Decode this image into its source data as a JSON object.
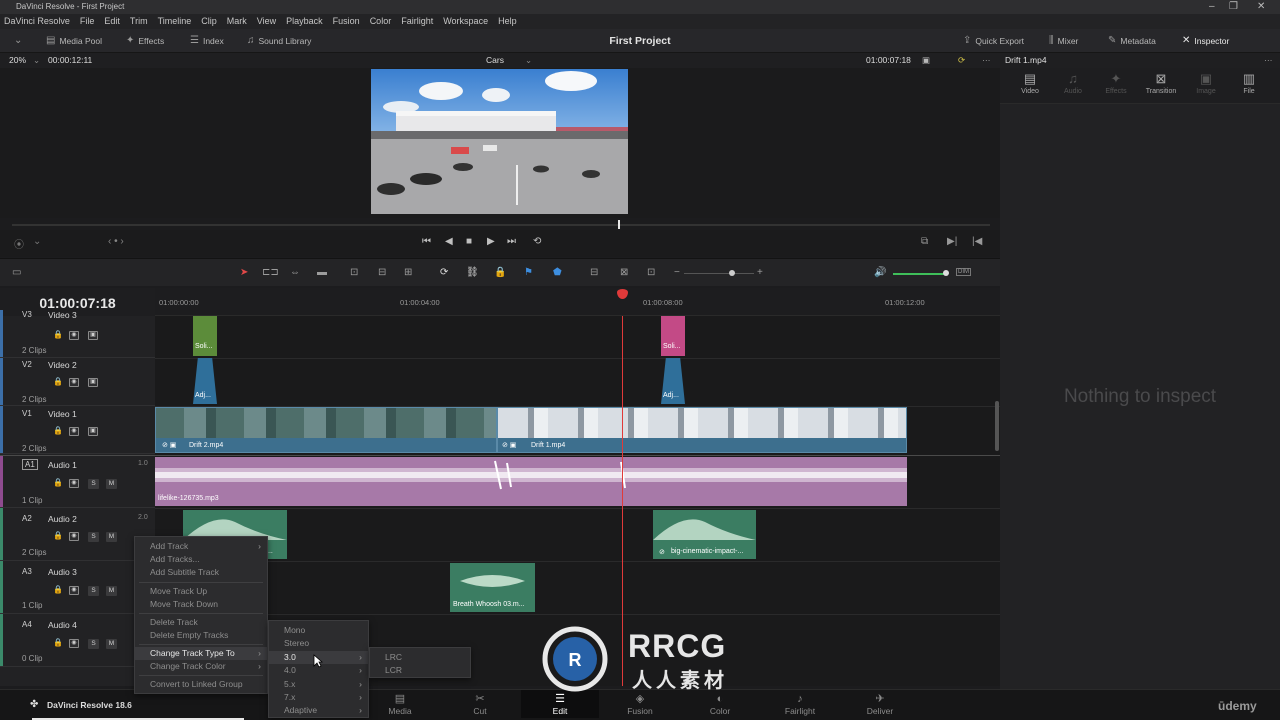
{
  "window": {
    "title": "DaVinci Resolve - First Project"
  },
  "menu": [
    "DaVinci Resolve",
    "File",
    "Edit",
    "Trim",
    "Timeline",
    "Clip",
    "Mark",
    "View",
    "Playback",
    "Fusion",
    "Color",
    "Fairlight",
    "Workspace",
    "Help"
  ],
  "toolbar": {
    "media_pool": "Media Pool",
    "effects": "Effects",
    "index": "Index",
    "sound_library": "Sound Library",
    "project_title": "First Project",
    "quick_export": "Quick Export",
    "mixer": "Mixer",
    "metadata": "Metadata",
    "inspector": "Inspector"
  },
  "viewer": {
    "zoom": "20%",
    "duration": "00:00:12:11",
    "timeline_name": "Cars",
    "timecode": "01:00:07:18"
  },
  "timeline": {
    "current_timecode": "01:00:07:18",
    "ruler": [
      "01:00:00:00",
      "01:00:04:00",
      "01:00:08:00",
      "01:00:12:00"
    ],
    "tracks": {
      "v3": {
        "id": "V3",
        "name": "Video 3",
        "clips": "2 Clips"
      },
      "v2": {
        "id": "V2",
        "name": "Video 2",
        "clips": "2 Clips"
      },
      "v1": {
        "id": "V1",
        "name": "Video 1",
        "clips": "2 Clips"
      },
      "a1": {
        "id": "A1",
        "name": "Audio 1",
        "level": "1.0",
        "clips": "1 Clip"
      },
      "a2": {
        "id": "A2",
        "name": "Audio 2",
        "level": "2.0",
        "clips": "2 Clips"
      },
      "a3": {
        "id": "A3",
        "name": "Audio 3",
        "clips": "1 Clip"
      },
      "a4": {
        "id": "A4",
        "name": "Audio 4",
        "clips": "0 Clip"
      }
    },
    "clips": {
      "solid1": "Soli...",
      "solid2": "Soli...",
      "adj1": "Adj...",
      "adj2": "Adj...",
      "drift2": "Drift 2.mp4",
      "drift1": "Drift 1.mp4",
      "lifelike": "lifelike-126735.mp3",
      "a2_left": "...",
      "big_cinematic": "big-cinematic-impact-...",
      "breath": "Breath Whoosh 03.m..."
    },
    "track_buttons": {
      "solo": "S",
      "mute": "M"
    }
  },
  "inspector": {
    "clip_name": "Drift 1.mp4",
    "tabs": [
      "Video",
      "Audio",
      "Effects",
      "Transition",
      "Image",
      "File"
    ],
    "empty_message": "Nothing to inspect"
  },
  "context_menu": {
    "items": [
      "Add Track",
      "Add Tracks...",
      "Add Subtitle Track",
      "Move Track Up",
      "Move Track Down",
      "Delete Track",
      "Delete Empty Tracks",
      "Change Track Type To",
      "Change Track Color",
      "Convert to Linked Group"
    ],
    "submenu": [
      "Mono",
      "Stereo",
      "3.0",
      "4.0",
      "5.x",
      "7.x",
      "Adaptive"
    ],
    "submenu2": [
      "LRC",
      "LCR"
    ]
  },
  "bottom": {
    "app_version": "DaVinci Resolve 18.6",
    "pages": [
      "Media",
      "Cut",
      "Edit",
      "Fusion",
      "Color",
      "Fairlight",
      "Deliver"
    ],
    "udemy": "ūdemy"
  },
  "watermark": {
    "brand": "RRCG",
    "sub": "人人素材"
  },
  "colors": {
    "accent_red": "#e03a3a",
    "video_clip": "#3d6f8e",
    "audio_clip_purple": "#a779a8",
    "audio_clip_green": "#3b7d62",
    "active_menu": "#3b3b3e"
  }
}
